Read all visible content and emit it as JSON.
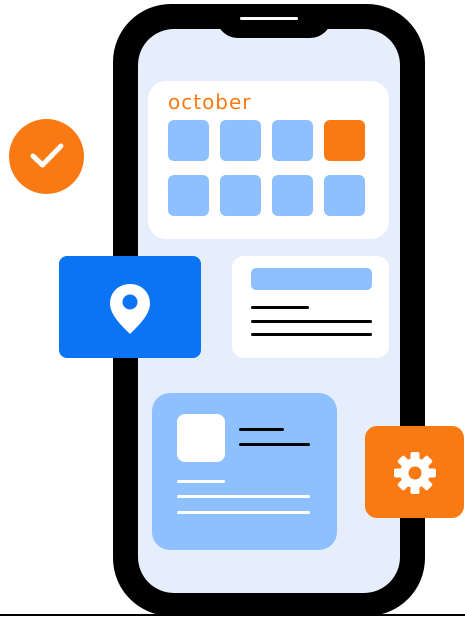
{
  "calendar": {
    "month": "october",
    "days": [
      {
        "highlighted": false
      },
      {
        "highlighted": false
      },
      {
        "highlighted": false
      },
      {
        "highlighted": true
      },
      {
        "highlighted": false
      },
      {
        "highlighted": false
      },
      {
        "highlighted": false
      },
      {
        "highlighted": false
      }
    ]
  },
  "icons": {
    "check": "check-icon",
    "location": "location-pin-icon",
    "settings": "gear-icon"
  },
  "colors": {
    "accent_orange": "#f97a12",
    "primary_blue": "#0a74f5",
    "light_blue": "#8ec0ff",
    "screen_bg": "#e6eefb"
  }
}
